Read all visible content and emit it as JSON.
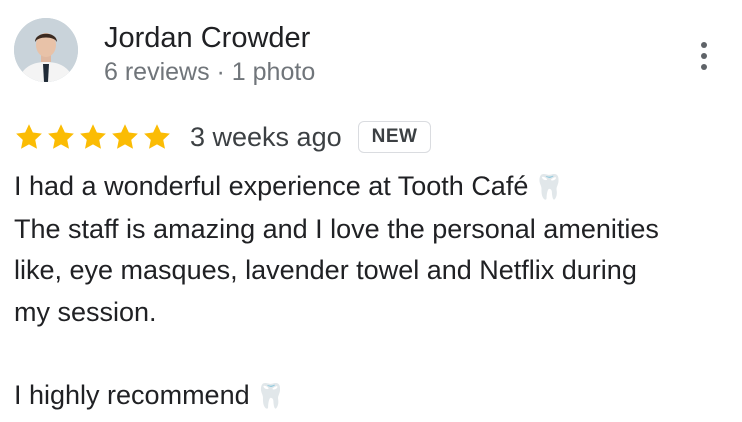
{
  "reviewer": {
    "name": "Jordan Crowder",
    "meta": "6 reviews · 1 photo"
  },
  "review": {
    "rating": 5,
    "rating_max": 5,
    "time": "3 weeks ago",
    "badge": "NEW",
    "lines": [
      "I had a wonderful experience at Tooth Café",
      "The staff is amazing and I love the personal amenities",
      "like, eye masques, lavender towel and Netflix during",
      "my session.",
      "",
      "I highly recommend"
    ],
    "emoji": "🦷"
  },
  "colors": {
    "star": "#fbbc04",
    "text": "#202124",
    "meta": "#70757a"
  },
  "icons": {
    "menu": "more-vert-icon",
    "star": "star-icon"
  }
}
